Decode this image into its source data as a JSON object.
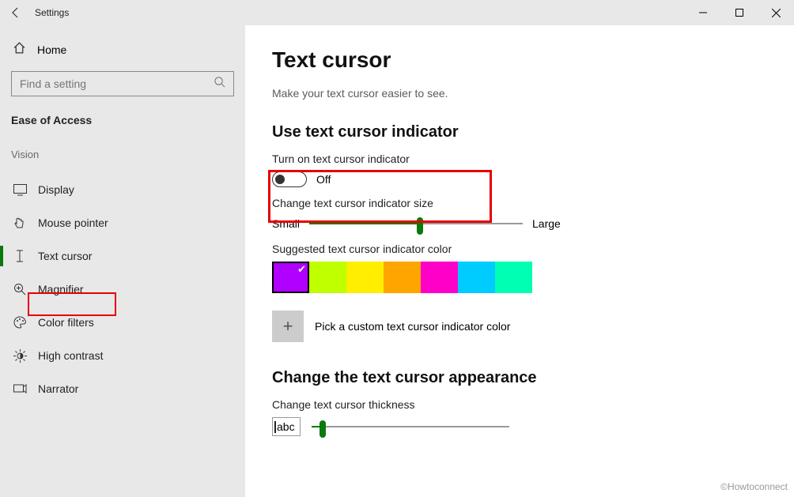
{
  "app": {
    "title": "Settings"
  },
  "sidebar": {
    "home": "Home",
    "search_placeholder": "Find a setting",
    "category": "Ease of Access",
    "group": "Vision",
    "items": [
      {
        "label": "Display"
      },
      {
        "label": "Mouse pointer"
      },
      {
        "label": "Text cursor"
      },
      {
        "label": "Magnifier"
      },
      {
        "label": "Color filters"
      },
      {
        "label": "High contrast"
      },
      {
        "label": "Narrator"
      }
    ]
  },
  "main": {
    "title": "Text cursor",
    "subtitle": "Make your text cursor easier to see.",
    "section1_heading": "Use text cursor indicator",
    "toggle_label": "Turn on text cursor indicator",
    "toggle_value": "Off",
    "size_label": "Change text cursor indicator size",
    "size_min": "Small",
    "size_max": "Large",
    "color_label": "Suggested text cursor indicator color",
    "colors": [
      "#b000ff",
      "#bfff00",
      "#ffee00",
      "#ffa500",
      "#ff00c8",
      "#00ccff",
      "#00ffb3"
    ],
    "custom_label": "Pick a custom text cursor indicator color",
    "section2_heading": "Change the text cursor appearance",
    "thickness_label": "Change text cursor thickness",
    "preview_text": "abc"
  },
  "watermark": "©Howtoconnect"
}
